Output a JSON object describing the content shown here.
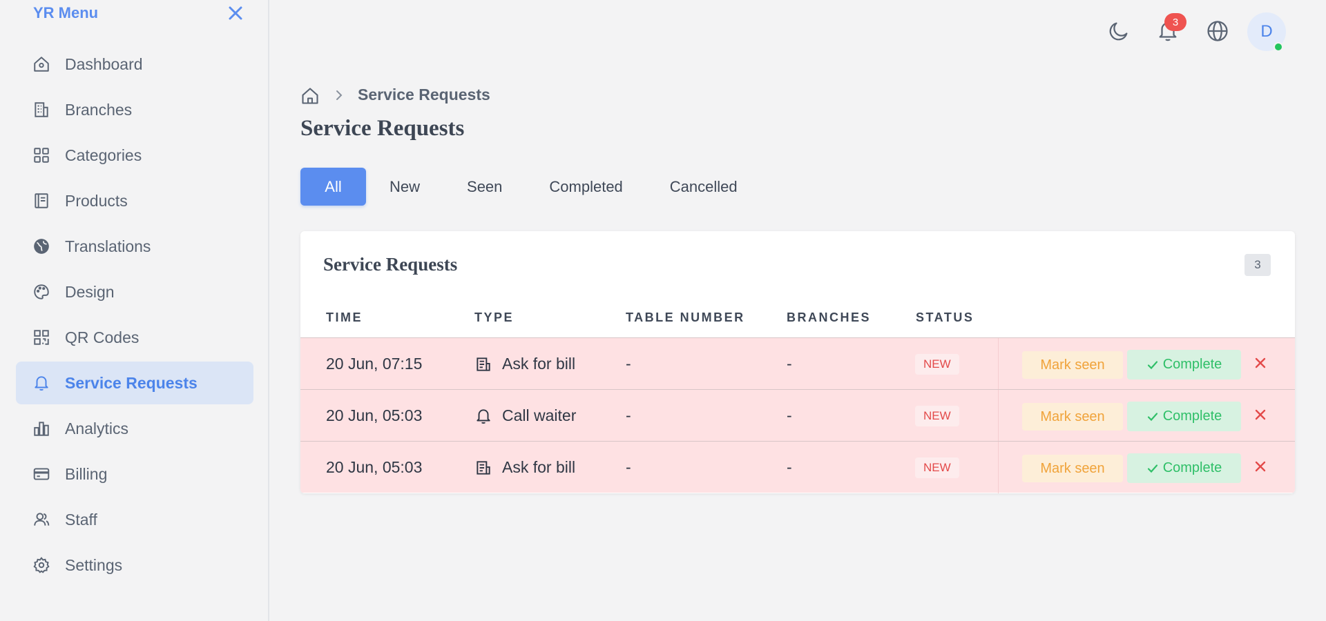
{
  "sidebar": {
    "brand": "YR Menu",
    "items": [
      {
        "label": "Dashboard",
        "icon": "home-icon"
      },
      {
        "label": "Branches",
        "icon": "building-icon"
      },
      {
        "label": "Categories",
        "icon": "grid-icon"
      },
      {
        "label": "Products",
        "icon": "book-icon"
      },
      {
        "label": "Translations",
        "icon": "globe-icon"
      },
      {
        "label": "Design",
        "icon": "palette-icon"
      },
      {
        "label": "QR Codes",
        "icon": "qr-code-icon"
      },
      {
        "label": "Service Requests",
        "icon": "bell-icon",
        "active": true
      },
      {
        "label": "Analytics",
        "icon": "bar-chart-icon"
      },
      {
        "label": "Billing",
        "icon": "credit-card-icon"
      },
      {
        "label": "Staff",
        "icon": "users-icon"
      },
      {
        "label": "Settings",
        "icon": "gear-icon"
      }
    ]
  },
  "topbar": {
    "notification_count": "3",
    "avatar_initial": "D"
  },
  "breadcrumb": {
    "current": "Service Requests"
  },
  "page": {
    "title": "Service Requests"
  },
  "tabs": [
    "All",
    "New",
    "Seen",
    "Completed",
    "Cancelled"
  ],
  "card": {
    "title": "Service Requests",
    "count": "3",
    "columns": [
      "TIME",
      "TYPE",
      "TABLE NUMBER",
      "BRANCHES",
      "STATUS"
    ],
    "rows": [
      {
        "time": "20 Jun, 07:15",
        "type": "Ask for bill",
        "type_icon": "receipt-icon",
        "table": "-",
        "branch": "-",
        "status": "NEW"
      },
      {
        "time": "20 Jun, 05:03",
        "type": "Call waiter",
        "type_icon": "bell-icon",
        "table": "-",
        "branch": "-",
        "status": "NEW"
      },
      {
        "time": "20 Jun, 05:03",
        "type": "Ask for bill",
        "type_icon": "receipt-icon",
        "table": "-",
        "branch": "-",
        "status": "NEW"
      }
    ],
    "actions": {
      "mark_seen": "Mark seen",
      "complete": "Complete"
    }
  },
  "colors": {
    "accent": "#5b8def",
    "row_new_bg": "#fee1e3",
    "status_new": "#e34a4a",
    "seen": "#f0a33a",
    "complete": "#2fbf68"
  }
}
